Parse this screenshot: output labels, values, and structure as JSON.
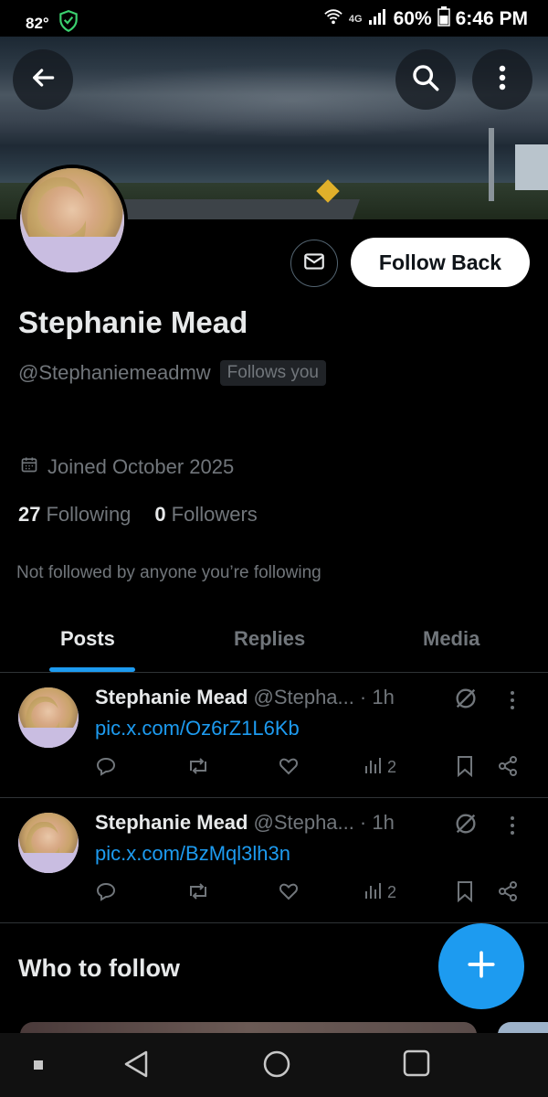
{
  "status_bar": {
    "temperature": "82°",
    "network": "4G",
    "battery": "60%",
    "time": "6:46 PM"
  },
  "profile": {
    "name": "Stephanie Mead",
    "handle": "@Stephaniemeadmw",
    "follows_you": "Follows you",
    "follow_back_label": "Follow Back",
    "joined": "Joined October 2025",
    "following_count": "27",
    "following_label": "Following",
    "followers_count": "0",
    "followers_label": "Followers",
    "not_followed_note": "Not followed by anyone you’re following"
  },
  "tabs": [
    {
      "label": "Posts",
      "active": true
    },
    {
      "label": "Replies",
      "active": false
    },
    {
      "label": "Media",
      "active": false
    }
  ],
  "posts": [
    {
      "name": "Stephanie Mead",
      "handle": "@Stepha...",
      "time": "· 1h",
      "link": "pic.x.com/Oz6rZ1L6Kb",
      "views": "2"
    },
    {
      "name": "Stephanie Mead",
      "handle": "@Stepha...",
      "time": "· 1h",
      "link": "pic.x.com/BzMql3lh3n",
      "views": "2"
    }
  ],
  "who_to_follow": {
    "title": "Who to follow"
  },
  "colors": {
    "accent": "#1d9bf0",
    "background": "#000000",
    "muted_text": "#71767b",
    "primary_text": "#e7e9ea"
  }
}
